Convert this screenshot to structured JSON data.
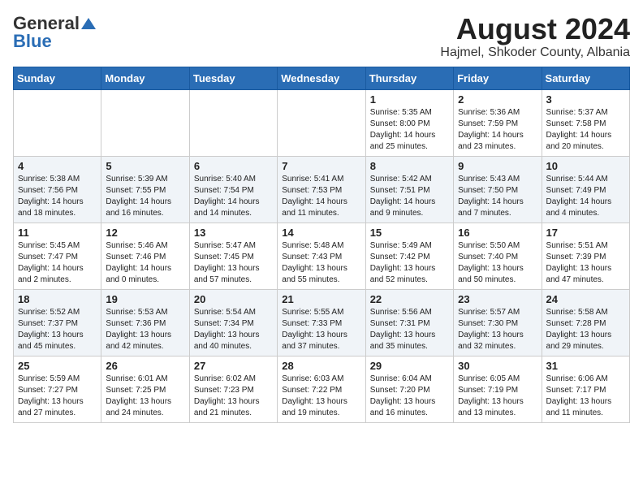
{
  "header": {
    "logo_general": "General",
    "logo_blue": "Blue",
    "month_title": "August 2024",
    "location": "Hajmel, Shkoder County, Albania"
  },
  "weekdays": [
    "Sunday",
    "Monday",
    "Tuesday",
    "Wednesday",
    "Thursday",
    "Friday",
    "Saturday"
  ],
  "weeks": [
    [
      {
        "day": "",
        "content": ""
      },
      {
        "day": "",
        "content": ""
      },
      {
        "day": "",
        "content": ""
      },
      {
        "day": "",
        "content": ""
      },
      {
        "day": "1",
        "content": "Sunrise: 5:35 AM\nSunset: 8:00 PM\nDaylight: 14 hours\nand 25 minutes."
      },
      {
        "day": "2",
        "content": "Sunrise: 5:36 AM\nSunset: 7:59 PM\nDaylight: 14 hours\nand 23 minutes."
      },
      {
        "day": "3",
        "content": "Sunrise: 5:37 AM\nSunset: 7:58 PM\nDaylight: 14 hours\nand 20 minutes."
      }
    ],
    [
      {
        "day": "4",
        "content": "Sunrise: 5:38 AM\nSunset: 7:56 PM\nDaylight: 14 hours\nand 18 minutes."
      },
      {
        "day": "5",
        "content": "Sunrise: 5:39 AM\nSunset: 7:55 PM\nDaylight: 14 hours\nand 16 minutes."
      },
      {
        "day": "6",
        "content": "Sunrise: 5:40 AM\nSunset: 7:54 PM\nDaylight: 14 hours\nand 14 minutes."
      },
      {
        "day": "7",
        "content": "Sunrise: 5:41 AM\nSunset: 7:53 PM\nDaylight: 14 hours\nand 11 minutes."
      },
      {
        "day": "8",
        "content": "Sunrise: 5:42 AM\nSunset: 7:51 PM\nDaylight: 14 hours\nand 9 minutes."
      },
      {
        "day": "9",
        "content": "Sunrise: 5:43 AM\nSunset: 7:50 PM\nDaylight: 14 hours\nand 7 minutes."
      },
      {
        "day": "10",
        "content": "Sunrise: 5:44 AM\nSunset: 7:49 PM\nDaylight: 14 hours\nand 4 minutes."
      }
    ],
    [
      {
        "day": "11",
        "content": "Sunrise: 5:45 AM\nSunset: 7:47 PM\nDaylight: 14 hours\nand 2 minutes."
      },
      {
        "day": "12",
        "content": "Sunrise: 5:46 AM\nSunset: 7:46 PM\nDaylight: 14 hours\nand 0 minutes."
      },
      {
        "day": "13",
        "content": "Sunrise: 5:47 AM\nSunset: 7:45 PM\nDaylight: 13 hours\nand 57 minutes."
      },
      {
        "day": "14",
        "content": "Sunrise: 5:48 AM\nSunset: 7:43 PM\nDaylight: 13 hours\nand 55 minutes."
      },
      {
        "day": "15",
        "content": "Sunrise: 5:49 AM\nSunset: 7:42 PM\nDaylight: 13 hours\nand 52 minutes."
      },
      {
        "day": "16",
        "content": "Sunrise: 5:50 AM\nSunset: 7:40 PM\nDaylight: 13 hours\nand 50 minutes."
      },
      {
        "day": "17",
        "content": "Sunrise: 5:51 AM\nSunset: 7:39 PM\nDaylight: 13 hours\nand 47 minutes."
      }
    ],
    [
      {
        "day": "18",
        "content": "Sunrise: 5:52 AM\nSunset: 7:37 PM\nDaylight: 13 hours\nand 45 minutes."
      },
      {
        "day": "19",
        "content": "Sunrise: 5:53 AM\nSunset: 7:36 PM\nDaylight: 13 hours\nand 42 minutes."
      },
      {
        "day": "20",
        "content": "Sunrise: 5:54 AM\nSunset: 7:34 PM\nDaylight: 13 hours\nand 40 minutes."
      },
      {
        "day": "21",
        "content": "Sunrise: 5:55 AM\nSunset: 7:33 PM\nDaylight: 13 hours\nand 37 minutes."
      },
      {
        "day": "22",
        "content": "Sunrise: 5:56 AM\nSunset: 7:31 PM\nDaylight: 13 hours\nand 35 minutes."
      },
      {
        "day": "23",
        "content": "Sunrise: 5:57 AM\nSunset: 7:30 PM\nDaylight: 13 hours\nand 32 minutes."
      },
      {
        "day": "24",
        "content": "Sunrise: 5:58 AM\nSunset: 7:28 PM\nDaylight: 13 hours\nand 29 minutes."
      }
    ],
    [
      {
        "day": "25",
        "content": "Sunrise: 5:59 AM\nSunset: 7:27 PM\nDaylight: 13 hours\nand 27 minutes."
      },
      {
        "day": "26",
        "content": "Sunrise: 6:01 AM\nSunset: 7:25 PM\nDaylight: 13 hours\nand 24 minutes."
      },
      {
        "day": "27",
        "content": "Sunrise: 6:02 AM\nSunset: 7:23 PM\nDaylight: 13 hours\nand 21 minutes."
      },
      {
        "day": "28",
        "content": "Sunrise: 6:03 AM\nSunset: 7:22 PM\nDaylight: 13 hours\nand 19 minutes."
      },
      {
        "day": "29",
        "content": "Sunrise: 6:04 AM\nSunset: 7:20 PM\nDaylight: 13 hours\nand 16 minutes."
      },
      {
        "day": "30",
        "content": "Sunrise: 6:05 AM\nSunset: 7:19 PM\nDaylight: 13 hours\nand 13 minutes."
      },
      {
        "day": "31",
        "content": "Sunrise: 6:06 AM\nSunset: 7:17 PM\nDaylight: 13 hours\nand 11 minutes."
      }
    ]
  ]
}
